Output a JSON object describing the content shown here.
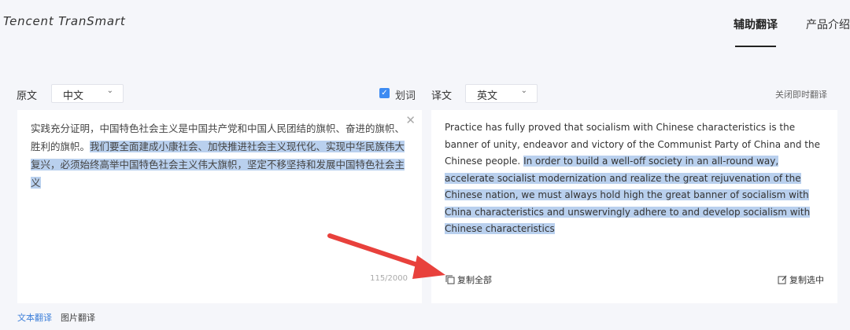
{
  "header": {
    "logo": "Tencent TranSmart",
    "nav": [
      "辅助翻译",
      "产品介绍"
    ]
  },
  "source": {
    "label": "原文",
    "language": "中文",
    "text_plain": "实践充分证明，中国特色社会主义是中国共产党和中国人民团结的旗帜、奋进的旗帜、胜利的旗帜。",
    "text_highlighted": "我们要全面建成小康社会、加快推进社会主义现代化、实现中华民族伟大复兴，必须始终高举中国特色社会主义伟大旗帜，坚定不移坚持和发展中国特色社会主义",
    "char_count": "115/2000"
  },
  "options": {
    "word_split_label": "划词",
    "word_split_checked": true
  },
  "target": {
    "label": "译文",
    "language": "英文",
    "close_instant_label": "关闭即时翻译",
    "text_plain": "Practice has fully proved that socialism with Chinese characteristics is the banner of unity, endeavor and victory of the Communist Party of China and the Chinese people.",
    "text_highlighted": "In order to build a well-off society in an all-round way, accelerate socialist modernization and realize the great rejuvenation of the Chinese nation, we must always hold high the great banner of socialism with China characteristics and unswervingly adhere to and develop socialism with Chinese characteristics",
    "copy_all_label": "复制全部",
    "copy_selected_label": "复制选中"
  },
  "bottom_tabs": [
    "文本翻译",
    "图片翻译"
  ],
  "colors": {
    "accent": "#3d8bf2",
    "highlight": "#b9d0ee",
    "annotation_arrow": "#e8413c"
  }
}
